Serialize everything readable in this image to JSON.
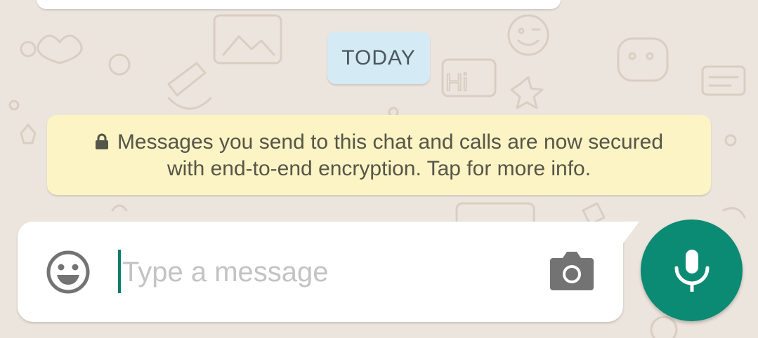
{
  "chat": {
    "date_divider": "TODAY",
    "encryption_notice": {
      "icon": "lock-icon",
      "line1": "Messages you send to this chat and calls are now secured",
      "line2": "with end-to-end encryption. Tap for more info."
    }
  },
  "composer": {
    "emoji_icon": "emoji-icon",
    "placeholder": "Type a message",
    "value": "",
    "camera_icon": "camera-icon",
    "mic_icon": "microphone-icon"
  },
  "wallpaper": {
    "label": "Hi"
  },
  "colors": {
    "background": "#ece5dd",
    "date_chip": "#d4eaf4",
    "notice": "#fcf4c4",
    "accent": "#0b8a74",
    "cursor": "#0b7c6b",
    "icon_gray": "#737373"
  }
}
